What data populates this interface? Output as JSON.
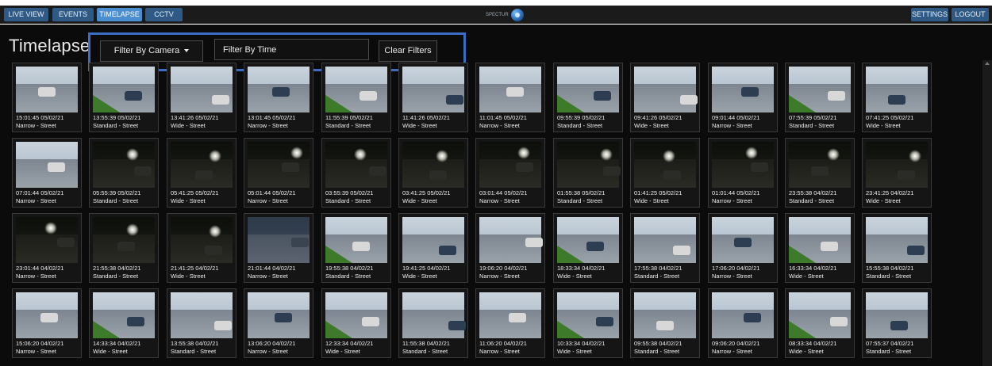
{
  "nav": {
    "tabs": [
      "LIVE VIEW",
      "EVENTS",
      "TIMELAPSE",
      "CCTV"
    ],
    "active_tab": "TIMELAPSE",
    "logo_text": "SPECTUR",
    "settings_label": "SETTINGS",
    "logout_label": "LOGOUT"
  },
  "page": {
    "title": "Timelapse"
  },
  "filters": {
    "camera_label": "Filter By Camera",
    "time_placeholder": "Filter By Time",
    "clear_label": "Clear Filters"
  },
  "colors": {
    "accent": "#4a8ed0",
    "nav_button": "#2f5a86",
    "highlight_box": "#3d6cc5",
    "background": "#0b0b0b"
  },
  "thumbnails": [
    {
      "time": "15:01:45 05/02/21",
      "camera": "Narrow - Street",
      "scene": "day"
    },
    {
      "time": "13:55:39 05/02/21",
      "camera": "Standard - Street",
      "scene": "day"
    },
    {
      "time": "13:41:26 05/02/21",
      "camera": "Wide - Street",
      "scene": "day"
    },
    {
      "time": "13:01:45 05/02/21",
      "camera": "Narrow - Street",
      "scene": "day"
    },
    {
      "time": "11:55:39 05/02/21",
      "camera": "Standard - Street",
      "scene": "day"
    },
    {
      "time": "11:41:26 05/02/21",
      "camera": "Wide - Street",
      "scene": "day"
    },
    {
      "time": "11:01:45 05/02/21",
      "camera": "Narrow - Street",
      "scene": "day"
    },
    {
      "time": "09:55:39 05/02/21",
      "camera": "Standard - Street",
      "scene": "day"
    },
    {
      "time": "09:41:26 05/02/21",
      "camera": "Wide - Street",
      "scene": "day"
    },
    {
      "time": "09:01:44 05/02/21",
      "camera": "Narrow - Street",
      "scene": "day"
    },
    {
      "time": "07:55:39 05/02/21",
      "camera": "Standard - Street",
      "scene": "day"
    },
    {
      "time": "07:41:25 05/02/21",
      "camera": "Wide - Street",
      "scene": "day"
    },
    {
      "time": "07:01:44 05/02/21",
      "camera": "Narrow - Street",
      "scene": "day"
    },
    {
      "time": "05:55:39 05/02/21",
      "camera": "Standard - Street",
      "scene": "night"
    },
    {
      "time": "05:41:25 05/02/21",
      "camera": "Wide - Street",
      "scene": "night"
    },
    {
      "time": "05:01:44 05/02/21",
      "camera": "Narrow - Street",
      "scene": "night"
    },
    {
      "time": "03:55:39 05/02/21",
      "camera": "Standard - Street",
      "scene": "night"
    },
    {
      "time": "03:41:25 05/02/21",
      "camera": "Wide - Street",
      "scene": "night"
    },
    {
      "time": "03:01:44 05/02/21",
      "camera": "Narrow - Street",
      "scene": "night"
    },
    {
      "time": "01:55:38 05/02/21",
      "camera": "Standard - Street",
      "scene": "night"
    },
    {
      "time": "01:41:25 05/02/21",
      "camera": "Wide - Street",
      "scene": "night"
    },
    {
      "time": "01:01:44 05/02/21",
      "camera": "Narrow - Street",
      "scene": "night"
    },
    {
      "time": "23:55:38 04/02/21",
      "camera": "Standard - Street",
      "scene": "night"
    },
    {
      "time": "23:41:25 04/02/21",
      "camera": "Wide - Street",
      "scene": "night"
    },
    {
      "time": "23:01:44 04/02/21",
      "camera": "Narrow - Street",
      "scene": "night"
    },
    {
      "time": "21:55:38 04/02/21",
      "camera": "Standard - Street",
      "scene": "night"
    },
    {
      "time": "21:41:25 04/02/21",
      "camera": "Wide - Street",
      "scene": "night"
    },
    {
      "time": "21:01:44 04/02/21",
      "camera": "Narrow - Street",
      "scene": "dusk"
    },
    {
      "time": "19:55:38 04/02/21",
      "camera": "Standard - Street",
      "scene": "day"
    },
    {
      "time": "19:41:25 04/02/21",
      "camera": "Wide - Street",
      "scene": "day"
    },
    {
      "time": "19:06:20 04/02/21",
      "camera": "Narrow - Street",
      "scene": "day"
    },
    {
      "time": "18:33:34 04/02/21",
      "camera": "Wide - Street",
      "scene": "day"
    },
    {
      "time": "17:55:38 04/02/21",
      "camera": "Standard - Street",
      "scene": "day"
    },
    {
      "time": "17:06:20 04/02/21",
      "camera": "Narrow - Street",
      "scene": "day"
    },
    {
      "time": "16:33:34 04/02/21",
      "camera": "Wide - Street",
      "scene": "day"
    },
    {
      "time": "15:55:38 04/02/21",
      "camera": "Standard - Street",
      "scene": "day"
    },
    {
      "time": "15:06:20 04/02/21",
      "camera": "Narrow - Street",
      "scene": "day"
    },
    {
      "time": "14:33:34 04/02/21",
      "camera": "Wide - Street",
      "scene": "day"
    },
    {
      "time": "13:55:38 04/02/21",
      "camera": "Standard - Street",
      "scene": "day"
    },
    {
      "time": "13:06:20 04/02/21",
      "camera": "Narrow - Street",
      "scene": "day"
    },
    {
      "time": "12:33:34 04/02/21",
      "camera": "Wide - Street",
      "scene": "day"
    },
    {
      "time": "11:55:38 04/02/21",
      "camera": "Standard - Street",
      "scene": "day"
    },
    {
      "time": "11:06:20 04/02/21",
      "camera": "Narrow - Street",
      "scene": "day"
    },
    {
      "time": "10:33:34 04/02/21",
      "camera": "Wide - Street",
      "scene": "day"
    },
    {
      "time": "09:55:38 04/02/21",
      "camera": "Standard - Street",
      "scene": "day"
    },
    {
      "time": "09:06:20 04/02/21",
      "camera": "Narrow - Street",
      "scene": "day"
    },
    {
      "time": "08:33:34 04/02/21",
      "camera": "Wide - Street",
      "scene": "day"
    },
    {
      "time": "07:55:37 04/02/21",
      "camera": "Standard - Street",
      "scene": "day"
    }
  ]
}
